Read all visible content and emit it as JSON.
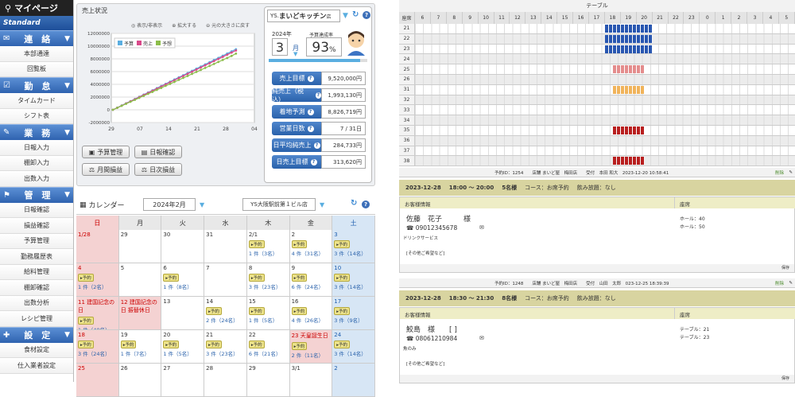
{
  "sidebar": {
    "title": "マイページ",
    "standard": "Standard",
    "sections": [
      {
        "label": "連　絡",
        "items": [
          "本部通達",
          "回覧板"
        ]
      },
      {
        "label": "勤　怠",
        "items": [
          "タイムカード",
          "シフト表"
        ]
      },
      {
        "label": "業　務",
        "items": [
          "日報入力",
          "棚卸入力",
          "出数入力"
        ]
      },
      {
        "label": "管　理",
        "items": [
          "日報確認",
          "損益確認",
          "予算管理",
          "勤務履歴表",
          "給料管理",
          "棚卸確認",
          "出数分析",
          "レシピ管理"
        ]
      },
      {
        "label": "設　定",
        "items": [
          "食材設定",
          "仕入業者設定"
        ]
      }
    ]
  },
  "sales": {
    "title": "売上状況",
    "links": [
      "表示/非表示",
      "拡大する",
      "元の大きさに戻す"
    ],
    "legend": [
      "予算",
      "売上",
      "予想"
    ],
    "buttons": [
      "予算管理",
      "日報確認",
      "月間損益",
      "日次損益"
    ]
  },
  "chart_data": {
    "type": "line",
    "x_ticks": [
      "29",
      "07",
      "14",
      "21",
      "28",
      "04"
    ],
    "y_ticks": [
      "12000000",
      "10000000",
      "8000000",
      "6000000",
      "4000000",
      "2000000",
      "0",
      "-2000000"
    ],
    "ylim": [
      -2000000,
      12000000
    ],
    "series": [
      {
        "name": "予算",
        "color": "#5aaee0",
        "values": [
          0,
          340000,
          680000,
          1020000,
          1360000,
          1700000,
          2040000,
          2380000,
          2720000,
          3060000,
          3400000,
          3740000,
          4080000,
          4420000,
          4760000,
          5100000,
          5440000,
          5780000,
          6120000,
          6460000,
          6800000,
          7140000,
          7480000,
          7820000,
          8160000,
          8500000,
          8840000,
          9180000,
          9520000
        ]
      },
      {
        "name": "売上",
        "color": "#d94a8a",
        "values": [
          0,
          320000,
          650000,
          990000,
          1320000,
          1650000,
          1990000,
          2320000,
          2650000,
          2990000,
          3320000,
          3650000,
          3990000,
          4320000,
          4650000,
          4990000,
          5320000,
          5650000,
          5990000,
          6320000,
          6650000,
          6990000,
          7320000,
          7650000,
          7990000,
          8320000,
          8650000,
          8990000,
          9320000
        ]
      },
      {
        "name": "予想",
        "color": "#8cbd4a",
        "values": [
          0,
          310000,
          620000,
          940000,
          1250000,
          1560000,
          1880000,
          2190000,
          2500000,
          2820000,
          3130000,
          3440000,
          3760000,
          4070000,
          4380000,
          4700000,
          5010000,
          5320000,
          5640000,
          5950000,
          6260000,
          6580000,
          6890000,
          7200000,
          7520000,
          7830000,
          8140000,
          8460000,
          8826719
        ]
      }
    ]
  },
  "store": {
    "prefix": "YS.",
    "name": "まいどキッチン",
    "suffix": "店",
    "year": "2024年",
    "month": "3",
    "month_unit": "月",
    "rate_label": "予算達成率",
    "rate": "93",
    "rate_unit": "%",
    "rate_fraction": 0.93,
    "stats": [
      {
        "label": "売上目標",
        "value": "9,520,000円"
      },
      {
        "label": "純売上（税込）",
        "value": "1,993,130円"
      },
      {
        "label": "着地予測",
        "value": "8,826,719円"
      },
      {
        "label": "営業日数",
        "value": "7 / 31日"
      },
      {
        "label": "日平均純売上",
        "value": "284,733円"
      },
      {
        "label": "日売上目標",
        "value": "313,620円"
      }
    ]
  },
  "calendar": {
    "title": "カレンダー",
    "month": "2024年2月",
    "store": "YS大阪駅前第１ビル店",
    "weekdays": [
      "日",
      "月",
      "火",
      "水",
      "木",
      "金",
      "土"
    ],
    "badge_label": "予約",
    "cells": [
      {
        "d": "1/28",
        "t": "sun"
      },
      {
        "d": "29"
      },
      {
        "d": "30"
      },
      {
        "d": "31"
      },
      {
        "d": "2/1",
        "b": true,
        "c": "1 件（3名）"
      },
      {
        "d": "2",
        "b": true,
        "c": "4 件（31名）"
      },
      {
        "d": "3",
        "t": "sat",
        "b": true,
        "c": "3 件（14名）"
      },
      {
        "d": "4",
        "t": "sun",
        "b": true,
        "c": "1 件（2名）"
      },
      {
        "d": "5"
      },
      {
        "d": "6",
        "b": true,
        "c": "1 件（8名）"
      },
      {
        "d": "7"
      },
      {
        "d": "8",
        "b": true,
        "c": "3 件（23名）"
      },
      {
        "d": "9",
        "b": true,
        "c": "6 件（24名）"
      },
      {
        "d": "10",
        "t": "sat",
        "b": true,
        "c": "3 件（14名）"
      },
      {
        "d": "11 建国記念の日",
        "t": "sun",
        "b": true,
        "c": "1 件（40名）"
      },
      {
        "d": "12 建国記念の日 振替休日",
        "t": "hol"
      },
      {
        "d": "13"
      },
      {
        "d": "14",
        "b": true,
        "c": "2 件（24名）"
      },
      {
        "d": "15",
        "b": true,
        "c": "1 件（5名）"
      },
      {
        "d": "16",
        "b": true,
        "c": "4 件（26名）"
      },
      {
        "d": "17",
        "t": "sat",
        "b": true,
        "c": "3 件（9名）"
      },
      {
        "d": "18",
        "t": "sun",
        "b": true,
        "c": "3 件（24名）"
      },
      {
        "d": "19",
        "b": true,
        "c": "1 件（7名）"
      },
      {
        "d": "20",
        "b": true,
        "c": "1 件（5名）"
      },
      {
        "d": "21",
        "b": true,
        "c": "3 件（23名）"
      },
      {
        "d": "22",
        "b": true,
        "c": "6 件（21名）"
      },
      {
        "d": "23 天皇誕生日",
        "t": "hol",
        "b": true,
        "c": "2 件（11名）"
      },
      {
        "d": "24",
        "t": "sat",
        "b": true,
        "c": "3 件（14名）"
      },
      {
        "d": "25",
        "t": "sun"
      },
      {
        "d": "26"
      },
      {
        "d": "27"
      },
      {
        "d": "28"
      },
      {
        "d": "29"
      },
      {
        "d": "3/1"
      },
      {
        "d": "2",
        "t": "sat"
      }
    ]
  },
  "timeline": {
    "title": "テーブル",
    "corner": "座席",
    "hours": [
      "6",
      "7",
      "8",
      "9",
      "10",
      "11",
      "12",
      "13",
      "14",
      "15",
      "16",
      "17",
      "18",
      "19",
      "20",
      "21",
      "22",
      "23",
      "0",
      "1",
      "2",
      "3",
      "4",
      "5"
    ],
    "rows": [
      {
        "n": "21",
        "bars": [
          {
            "from": 18,
            "to": 21,
            "color": "#2856b0"
          }
        ]
      },
      {
        "n": "22",
        "bars": [
          {
            "from": 18,
            "to": 21,
            "color": "#2856b0"
          }
        ]
      },
      {
        "n": "23",
        "bars": [
          {
            "from": 18,
            "to": 21,
            "color": "#2856b0"
          }
        ]
      },
      {
        "n": "24",
        "bars": []
      },
      {
        "n": "25",
        "bars": [
          {
            "from": 18.5,
            "to": 20.5,
            "color": "#e48c8c"
          }
        ]
      },
      {
        "n": "26",
        "bars": []
      },
      {
        "n": "31",
        "bars": [
          {
            "from": 18.5,
            "to": 20.5,
            "color": "#f0b35a"
          }
        ]
      },
      {
        "n": "32",
        "bars": []
      },
      {
        "n": "33",
        "bars": []
      },
      {
        "n": "34",
        "bars": []
      },
      {
        "n": "35",
        "bars": [
          {
            "from": 18.5,
            "to": 20.5,
            "color": "#b81e1e"
          }
        ]
      },
      {
        "n": "36",
        "bars": []
      },
      {
        "n": "37",
        "bars": []
      },
      {
        "n": "38",
        "bars": [
          {
            "from": 18.5,
            "to": 20.5,
            "color": "#b81e1e"
          }
        ]
      }
    ]
  },
  "reservations": [
    {
      "meta": "予約ID：1254　　店舗 まいど屋　梅田店　　受付　本田 和大　2023-12-20 10:58:41",
      "edit": "削除",
      "date": "2023-12-28",
      "time": "18:00 〜 20:00",
      "people": "5名様",
      "course": "コース：お席予約",
      "drink": "飲み放題：なし",
      "info_head": "お客様情報",
      "seat_head": "座席",
      "name": "佐藤　花子　　　様",
      "phone": "☎ 09012345678",
      "memo": "ドリンクサービス",
      "note": "[その他ご希望など]",
      "seats": [
        "ホール：40",
        "ホール：50"
      ],
      "footer": "保存"
    },
    {
      "meta": "予約ID：1248　　店舗 まいど屋　梅田店　　受付　山田　太郎　023-12-25 18:39:39",
      "edit": "削除",
      "date": "2023-12-28",
      "time": "18:30 〜 21:30",
      "people": "8名様",
      "course": "コース：お席予約",
      "drink": "飲み放題：なし",
      "info_head": "お客様情報",
      "seat_head": "座席",
      "name": "鮫島　様　　[ ]",
      "phone": "☎ 08061210984",
      "memo": "魚のみ",
      "note": "[その他ご希望など]",
      "seats": [
        "テーブル：21",
        "テーブル：23"
      ],
      "footer": "保存"
    }
  ]
}
